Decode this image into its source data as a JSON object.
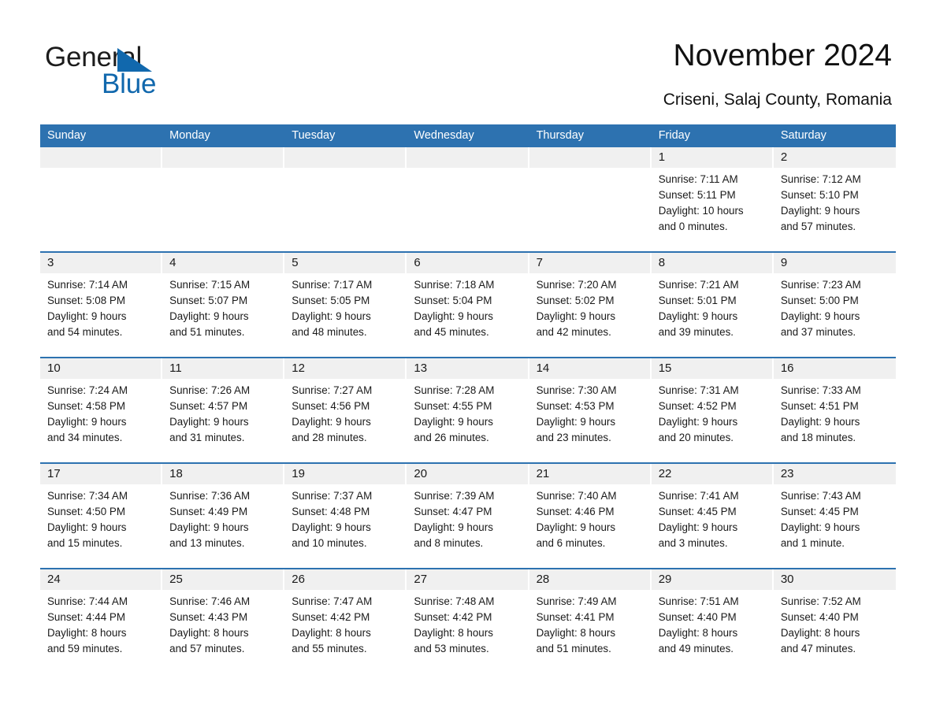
{
  "brand": {
    "name_part1": "General",
    "name_part2": "Blue",
    "triangle_color": "#1168ad",
    "text_color": "#1c1c1c"
  },
  "header": {
    "title": "November 2024",
    "location": "Criseni, Salaj County, Romania"
  },
  "theme": {
    "accent_blue": "#2d72b0",
    "daynum_band": "#f0f0f0",
    "header_text": "#ffffff",
    "body_text": "#1a1a1a"
  },
  "weekdays": [
    "Sunday",
    "Monday",
    "Tuesday",
    "Wednesday",
    "Thursday",
    "Friday",
    "Saturday"
  ],
  "weeks": [
    [
      {
        "day": "",
        "lines": []
      },
      {
        "day": "",
        "lines": []
      },
      {
        "day": "",
        "lines": []
      },
      {
        "day": "",
        "lines": []
      },
      {
        "day": "",
        "lines": []
      },
      {
        "day": "1",
        "lines": [
          "Sunrise: 7:11 AM",
          "Sunset: 5:11 PM",
          "Daylight: 10 hours",
          "and 0 minutes."
        ]
      },
      {
        "day": "2",
        "lines": [
          "Sunrise: 7:12 AM",
          "Sunset: 5:10 PM",
          "Daylight: 9 hours",
          "and 57 minutes."
        ]
      }
    ],
    [
      {
        "day": "3",
        "lines": [
          "Sunrise: 7:14 AM",
          "Sunset: 5:08 PM",
          "Daylight: 9 hours",
          "and 54 minutes."
        ]
      },
      {
        "day": "4",
        "lines": [
          "Sunrise: 7:15 AM",
          "Sunset: 5:07 PM",
          "Daylight: 9 hours",
          "and 51 minutes."
        ]
      },
      {
        "day": "5",
        "lines": [
          "Sunrise: 7:17 AM",
          "Sunset: 5:05 PM",
          "Daylight: 9 hours",
          "and 48 minutes."
        ]
      },
      {
        "day": "6",
        "lines": [
          "Sunrise: 7:18 AM",
          "Sunset: 5:04 PM",
          "Daylight: 9 hours",
          "and 45 minutes."
        ]
      },
      {
        "day": "7",
        "lines": [
          "Sunrise: 7:20 AM",
          "Sunset: 5:02 PM",
          "Daylight: 9 hours",
          "and 42 minutes."
        ]
      },
      {
        "day": "8",
        "lines": [
          "Sunrise: 7:21 AM",
          "Sunset: 5:01 PM",
          "Daylight: 9 hours",
          "and 39 minutes."
        ]
      },
      {
        "day": "9",
        "lines": [
          "Sunrise: 7:23 AM",
          "Sunset: 5:00 PM",
          "Daylight: 9 hours",
          "and 37 minutes."
        ]
      }
    ],
    [
      {
        "day": "10",
        "lines": [
          "Sunrise: 7:24 AM",
          "Sunset: 4:58 PM",
          "Daylight: 9 hours",
          "and 34 minutes."
        ]
      },
      {
        "day": "11",
        "lines": [
          "Sunrise: 7:26 AM",
          "Sunset: 4:57 PM",
          "Daylight: 9 hours",
          "and 31 minutes."
        ]
      },
      {
        "day": "12",
        "lines": [
          "Sunrise: 7:27 AM",
          "Sunset: 4:56 PM",
          "Daylight: 9 hours",
          "and 28 minutes."
        ]
      },
      {
        "day": "13",
        "lines": [
          "Sunrise: 7:28 AM",
          "Sunset: 4:55 PM",
          "Daylight: 9 hours",
          "and 26 minutes."
        ]
      },
      {
        "day": "14",
        "lines": [
          "Sunrise: 7:30 AM",
          "Sunset: 4:53 PM",
          "Daylight: 9 hours",
          "and 23 minutes."
        ]
      },
      {
        "day": "15",
        "lines": [
          "Sunrise: 7:31 AM",
          "Sunset: 4:52 PM",
          "Daylight: 9 hours",
          "and 20 minutes."
        ]
      },
      {
        "day": "16",
        "lines": [
          "Sunrise: 7:33 AM",
          "Sunset: 4:51 PM",
          "Daylight: 9 hours",
          "and 18 minutes."
        ]
      }
    ],
    [
      {
        "day": "17",
        "lines": [
          "Sunrise: 7:34 AM",
          "Sunset: 4:50 PM",
          "Daylight: 9 hours",
          "and 15 minutes."
        ]
      },
      {
        "day": "18",
        "lines": [
          "Sunrise: 7:36 AM",
          "Sunset: 4:49 PM",
          "Daylight: 9 hours",
          "and 13 minutes."
        ]
      },
      {
        "day": "19",
        "lines": [
          "Sunrise: 7:37 AM",
          "Sunset: 4:48 PM",
          "Daylight: 9 hours",
          "and 10 minutes."
        ]
      },
      {
        "day": "20",
        "lines": [
          "Sunrise: 7:39 AM",
          "Sunset: 4:47 PM",
          "Daylight: 9 hours",
          "and 8 minutes."
        ]
      },
      {
        "day": "21",
        "lines": [
          "Sunrise: 7:40 AM",
          "Sunset: 4:46 PM",
          "Daylight: 9 hours",
          "and 6 minutes."
        ]
      },
      {
        "day": "22",
        "lines": [
          "Sunrise: 7:41 AM",
          "Sunset: 4:45 PM",
          "Daylight: 9 hours",
          "and 3 minutes."
        ]
      },
      {
        "day": "23",
        "lines": [
          "Sunrise: 7:43 AM",
          "Sunset: 4:45 PM",
          "Daylight: 9 hours",
          "and 1 minute."
        ]
      }
    ],
    [
      {
        "day": "24",
        "lines": [
          "Sunrise: 7:44 AM",
          "Sunset: 4:44 PM",
          "Daylight: 8 hours",
          "and 59 minutes."
        ]
      },
      {
        "day": "25",
        "lines": [
          "Sunrise: 7:46 AM",
          "Sunset: 4:43 PM",
          "Daylight: 8 hours",
          "and 57 minutes."
        ]
      },
      {
        "day": "26",
        "lines": [
          "Sunrise: 7:47 AM",
          "Sunset: 4:42 PM",
          "Daylight: 8 hours",
          "and 55 minutes."
        ]
      },
      {
        "day": "27",
        "lines": [
          "Sunrise: 7:48 AM",
          "Sunset: 4:42 PM",
          "Daylight: 8 hours",
          "and 53 minutes."
        ]
      },
      {
        "day": "28",
        "lines": [
          "Sunrise: 7:49 AM",
          "Sunset: 4:41 PM",
          "Daylight: 8 hours",
          "and 51 minutes."
        ]
      },
      {
        "day": "29",
        "lines": [
          "Sunrise: 7:51 AM",
          "Sunset: 4:40 PM",
          "Daylight: 8 hours",
          "and 49 minutes."
        ]
      },
      {
        "day": "30",
        "lines": [
          "Sunrise: 7:52 AM",
          "Sunset: 4:40 PM",
          "Daylight: 8 hours",
          "and 47 minutes."
        ]
      }
    ]
  ]
}
